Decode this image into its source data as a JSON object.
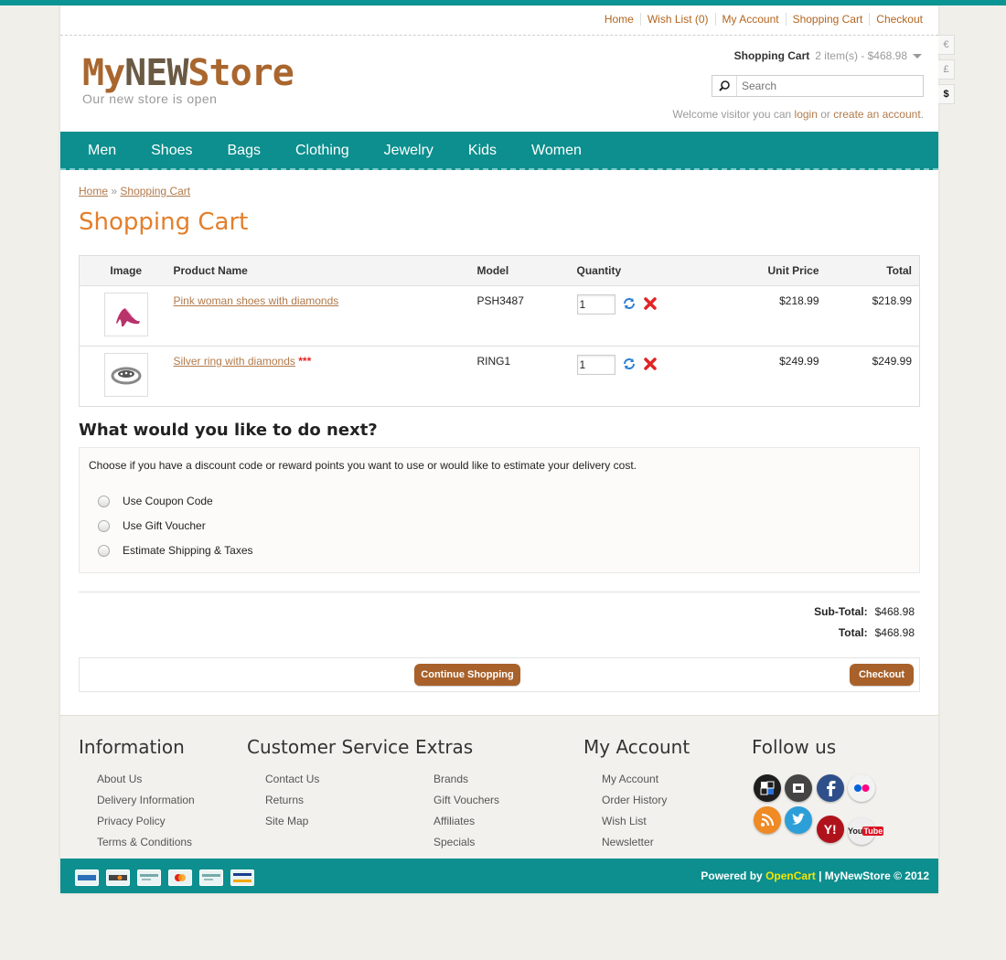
{
  "top_links": [
    "Home",
    "Wish List (0)",
    "My Account",
    "Shopping Cart",
    "Checkout"
  ],
  "logo": {
    "part1": "My",
    "part2": "NEW",
    "part3": "Store",
    "tagline": "Our new store is open"
  },
  "cart_summary": {
    "label": "Shopping Cart",
    "value": "2 item(s) - $468.98"
  },
  "search": {
    "placeholder": "Search"
  },
  "welcome": {
    "text_before": "Welcome visitor you can ",
    "login": "login",
    "or": " or ",
    "create": "create an account",
    "end": "."
  },
  "currencies": [
    "€",
    "£",
    "$"
  ],
  "nav": [
    "Men",
    "Shoes",
    "Bags",
    "Clothing",
    "Jewelry",
    "Kids",
    "Women"
  ],
  "breadcrumb": {
    "home": "Home",
    "sep": "»",
    "current": "Shopping Cart"
  },
  "page_title": "Shopping Cart",
  "table": {
    "headers": {
      "image": "Image",
      "name": "Product Name",
      "model": "Model",
      "quantity": "Quantity",
      "unit_price": "Unit Price",
      "total": "Total"
    },
    "rows": [
      {
        "name": "Pink woman shoes with diamonds",
        "stock_mark": "",
        "model": "PSH3487",
        "qty": "1",
        "unit_price": "$218.99",
        "total": "$218.99"
      },
      {
        "name": "Silver ring with diamonds",
        "stock_mark": "***",
        "model": "RING1",
        "qty": "1",
        "unit_price": "$249.99",
        "total": "$249.99"
      }
    ]
  },
  "next": {
    "title": "What would you like to do next?",
    "intro": "Choose if you have a discount code or reward points you want to use or would like to estimate your delivery cost.",
    "options": [
      "Use Coupon Code",
      "Use Gift Voucher",
      "Estimate Shipping & Taxes"
    ]
  },
  "totals": {
    "subtotal_label": "Sub-Total:",
    "subtotal": "$468.98",
    "total_label": "Total:",
    "total": "$468.98"
  },
  "buttons": {
    "continue": "Continue Shopping",
    "checkout": "Checkout"
  },
  "footer": {
    "information": {
      "title": "Information",
      "links": [
        "About Us",
        "Delivery Information",
        "Privacy Policy",
        "Terms & Conditions"
      ]
    },
    "customer_service": {
      "title": "Customer Service",
      "links": [
        "Contact Us",
        "Returns",
        "Site Map"
      ]
    },
    "extras": {
      "title": "Extras",
      "links": [
        "Brands",
        "Gift Vouchers",
        "Affiliates",
        "Specials"
      ]
    },
    "my_account": {
      "title": "My Account",
      "links": [
        "My Account",
        "Order History",
        "Wish List",
        "Newsletter"
      ]
    },
    "follow": {
      "title": "Follow us"
    }
  },
  "social_icons": [
    "delicious-icon",
    "digg-icon",
    "facebook-icon",
    "flickr-icon",
    "rss-icon",
    "twitter-icon",
    "yahoo-icon",
    "youtube-icon"
  ],
  "payment_icons": [
    "amex-icon",
    "discover-icon",
    "generic-card-icon",
    "mastercard-icon",
    "generic-card-icon",
    "visa-icon"
  ],
  "powered": {
    "prefix": "Powered by ",
    "brand": "OpenCart",
    "suffix": " | MyNewStore © 2012"
  },
  "colors": {
    "teal": "#0c8f8e",
    "brown": "#a8612a",
    "title_orange": "#e37f2b",
    "link": "#b17a4b"
  }
}
